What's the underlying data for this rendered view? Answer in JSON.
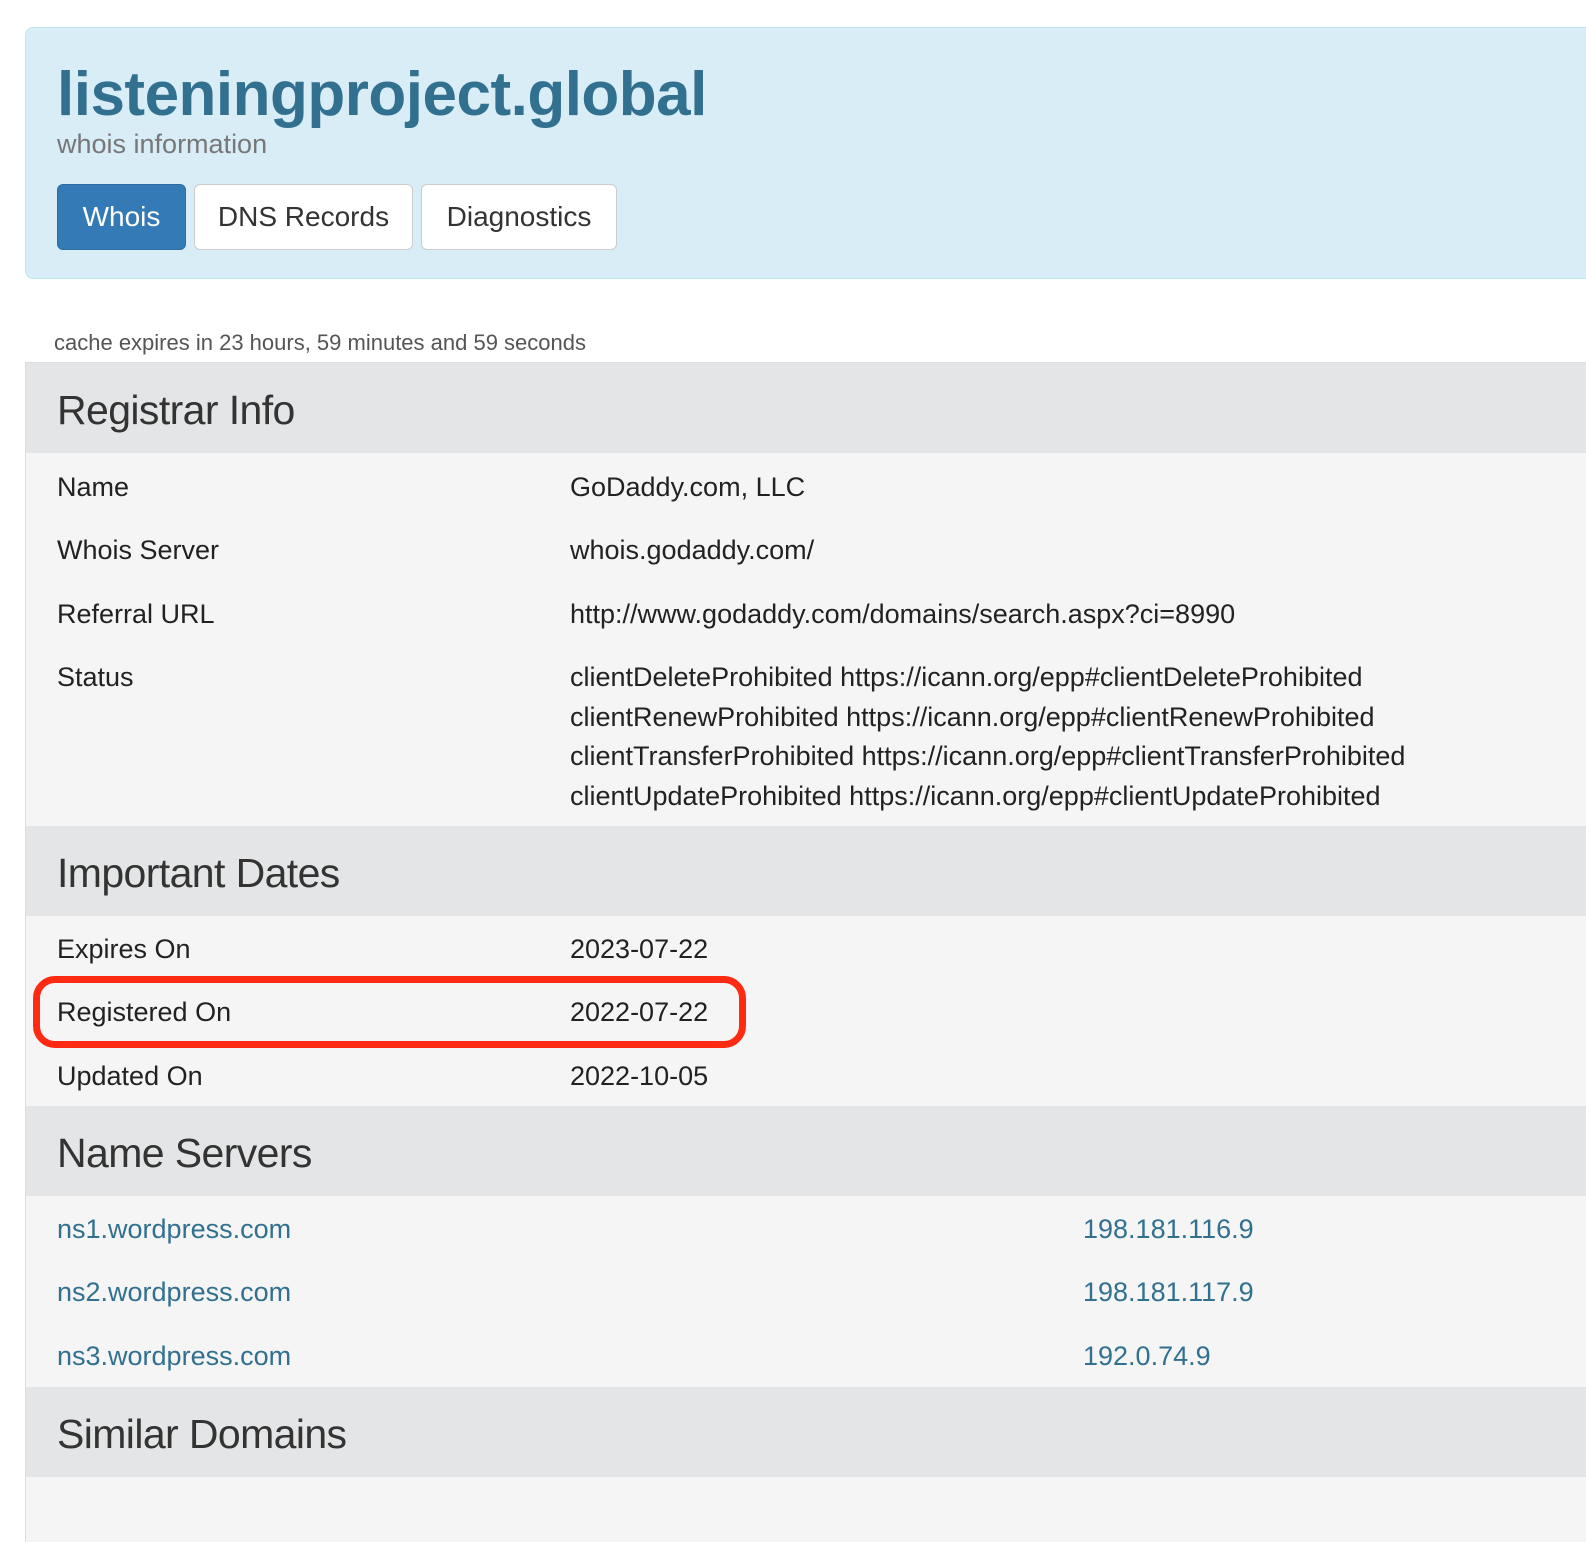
{
  "header": {
    "domain": "listeningproject.global",
    "subtitle": "whois information",
    "tabs": [
      {
        "label": "Whois",
        "active": true
      },
      {
        "label": "DNS Records",
        "active": false
      },
      {
        "label": "Diagnostics",
        "active": false
      }
    ]
  },
  "cache_note": "cache expires in 23 hours, 59 minutes and 59 seconds",
  "registrar": {
    "heading": "Registrar Info",
    "rows": [
      {
        "label": "Name",
        "value": "GoDaddy.com, LLC"
      },
      {
        "label": "Whois Server",
        "value": "whois.godaddy.com/"
      },
      {
        "label": "Referral URL",
        "value": "http://www.godaddy.com/domains/search.aspx?ci=8990"
      },
      {
        "label": "Status",
        "values": [
          "clientDeleteProhibited https://icann.org/epp#clientDeleteProhibited",
          "clientRenewProhibited https://icann.org/epp#clientRenewProhibited",
          "clientTransferProhibited https://icann.org/epp#clientTransferProhibited",
          "clientUpdateProhibited https://icann.org/epp#clientUpdateProhibited"
        ]
      }
    ]
  },
  "dates": {
    "heading": "Important Dates",
    "rows": [
      {
        "label": "Expires On",
        "value": "2023-07-22"
      },
      {
        "label": "Registered On",
        "value": "2022-07-22"
      },
      {
        "label": "Updated On",
        "value": "2022-10-05"
      }
    ]
  },
  "name_servers": {
    "heading": "Name Servers",
    "rows": [
      {
        "host": "ns1.wordpress.com",
        "ip": "198.181.116.9"
      },
      {
        "host": "ns2.wordpress.com",
        "ip": "198.181.117.9"
      },
      {
        "host": "ns3.wordpress.com",
        "ip": "192.0.74.9"
      }
    ]
  },
  "similar": {
    "heading": "Similar Domains"
  },
  "colors": {
    "accent": "#337ab7",
    "link": "#31708f",
    "highlight": "#ff2a12",
    "jumbotron": "#d9edf7"
  }
}
